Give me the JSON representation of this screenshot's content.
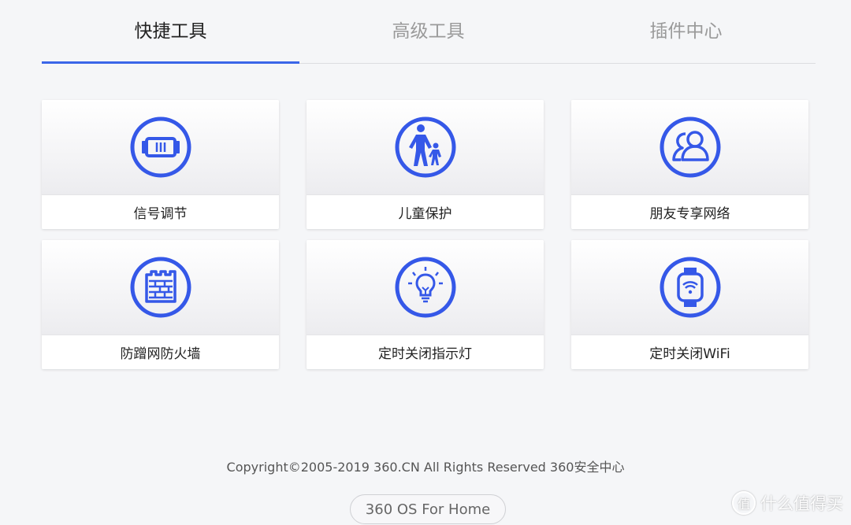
{
  "tabs": [
    {
      "label": "快捷工具",
      "active": true
    },
    {
      "label": "高级工具",
      "active": false
    },
    {
      "label": "插件中心",
      "active": false
    }
  ],
  "tools": [
    {
      "label": "信号调节",
      "icon": "signal-adjust-icon"
    },
    {
      "label": "儿童保护",
      "icon": "child-protection-icon"
    },
    {
      "label": "朋友专享网络",
      "icon": "friends-network-icon"
    },
    {
      "label": "防蹭网防火墙",
      "icon": "firewall-icon"
    },
    {
      "label": "定时关闭指示灯",
      "icon": "lightbulb-icon"
    },
    {
      "label": "定时关闭WiFi",
      "icon": "wifi-watch-icon"
    }
  ],
  "footer": {
    "copyright": "Copyright©2005-2019 360.CN All Rights Reserved 360安全中心",
    "os_label": "360 OS For Home"
  },
  "watermark": {
    "logo_char": "值",
    "text": "什么值得买"
  },
  "colors": {
    "accent": "#3a66e8",
    "icon_blue": "#3558e8"
  }
}
